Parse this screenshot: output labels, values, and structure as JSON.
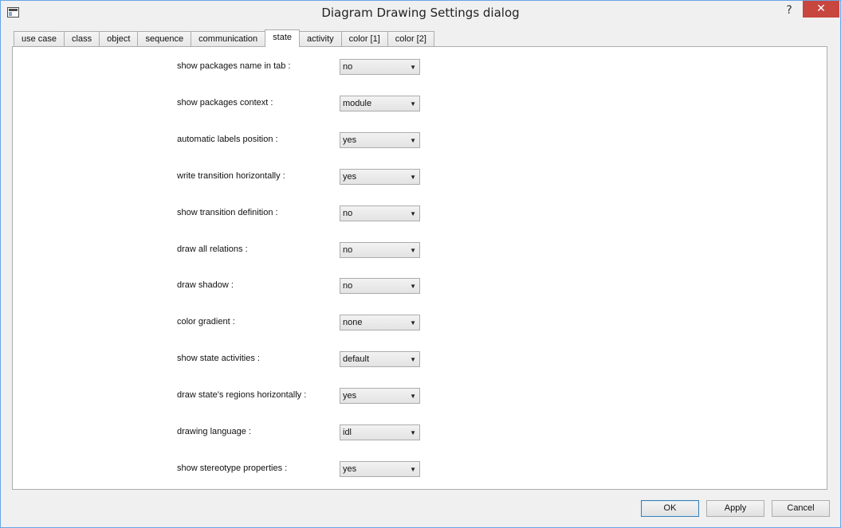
{
  "window": {
    "title": "Diagram Drawing Settings dialog",
    "help": "?",
    "close": "✕"
  },
  "tabs": [
    {
      "label": "use case"
    },
    {
      "label": "class"
    },
    {
      "label": "object"
    },
    {
      "label": "sequence"
    },
    {
      "label": "communication"
    },
    {
      "label": "state",
      "active": true
    },
    {
      "label": "activity"
    },
    {
      "label": "color [1]"
    },
    {
      "label": "color [2]"
    }
  ],
  "settings": [
    {
      "label": "show packages name in tab :",
      "value": "no"
    },
    {
      "label": "show packages context :",
      "value": "module"
    },
    {
      "label": "automatic labels position :",
      "value": "yes"
    },
    {
      "label": "write transition horizontally :",
      "value": "yes"
    },
    {
      "label": "show transition definition :",
      "value": "no"
    },
    {
      "label": "draw all relations :",
      "value": "no"
    },
    {
      "label": "draw shadow :",
      "value": "no"
    },
    {
      "label": "color gradient :",
      "value": "none"
    },
    {
      "label": "show state activities :",
      "value": "default"
    },
    {
      "label": "draw state's regions horizontally :",
      "value": "yes"
    },
    {
      "label": "drawing language :",
      "value": "idl"
    },
    {
      "label": "show stereotype properties :",
      "value": "yes"
    }
  ],
  "buttons": {
    "ok": "OK",
    "apply": "Apply",
    "cancel": "Cancel"
  },
  "colors": {
    "close_button": "#c7463e",
    "window_border": "#6aa5e6"
  },
  "icons": {
    "window": "window-icon",
    "dropdown": "chevron-down-icon"
  }
}
